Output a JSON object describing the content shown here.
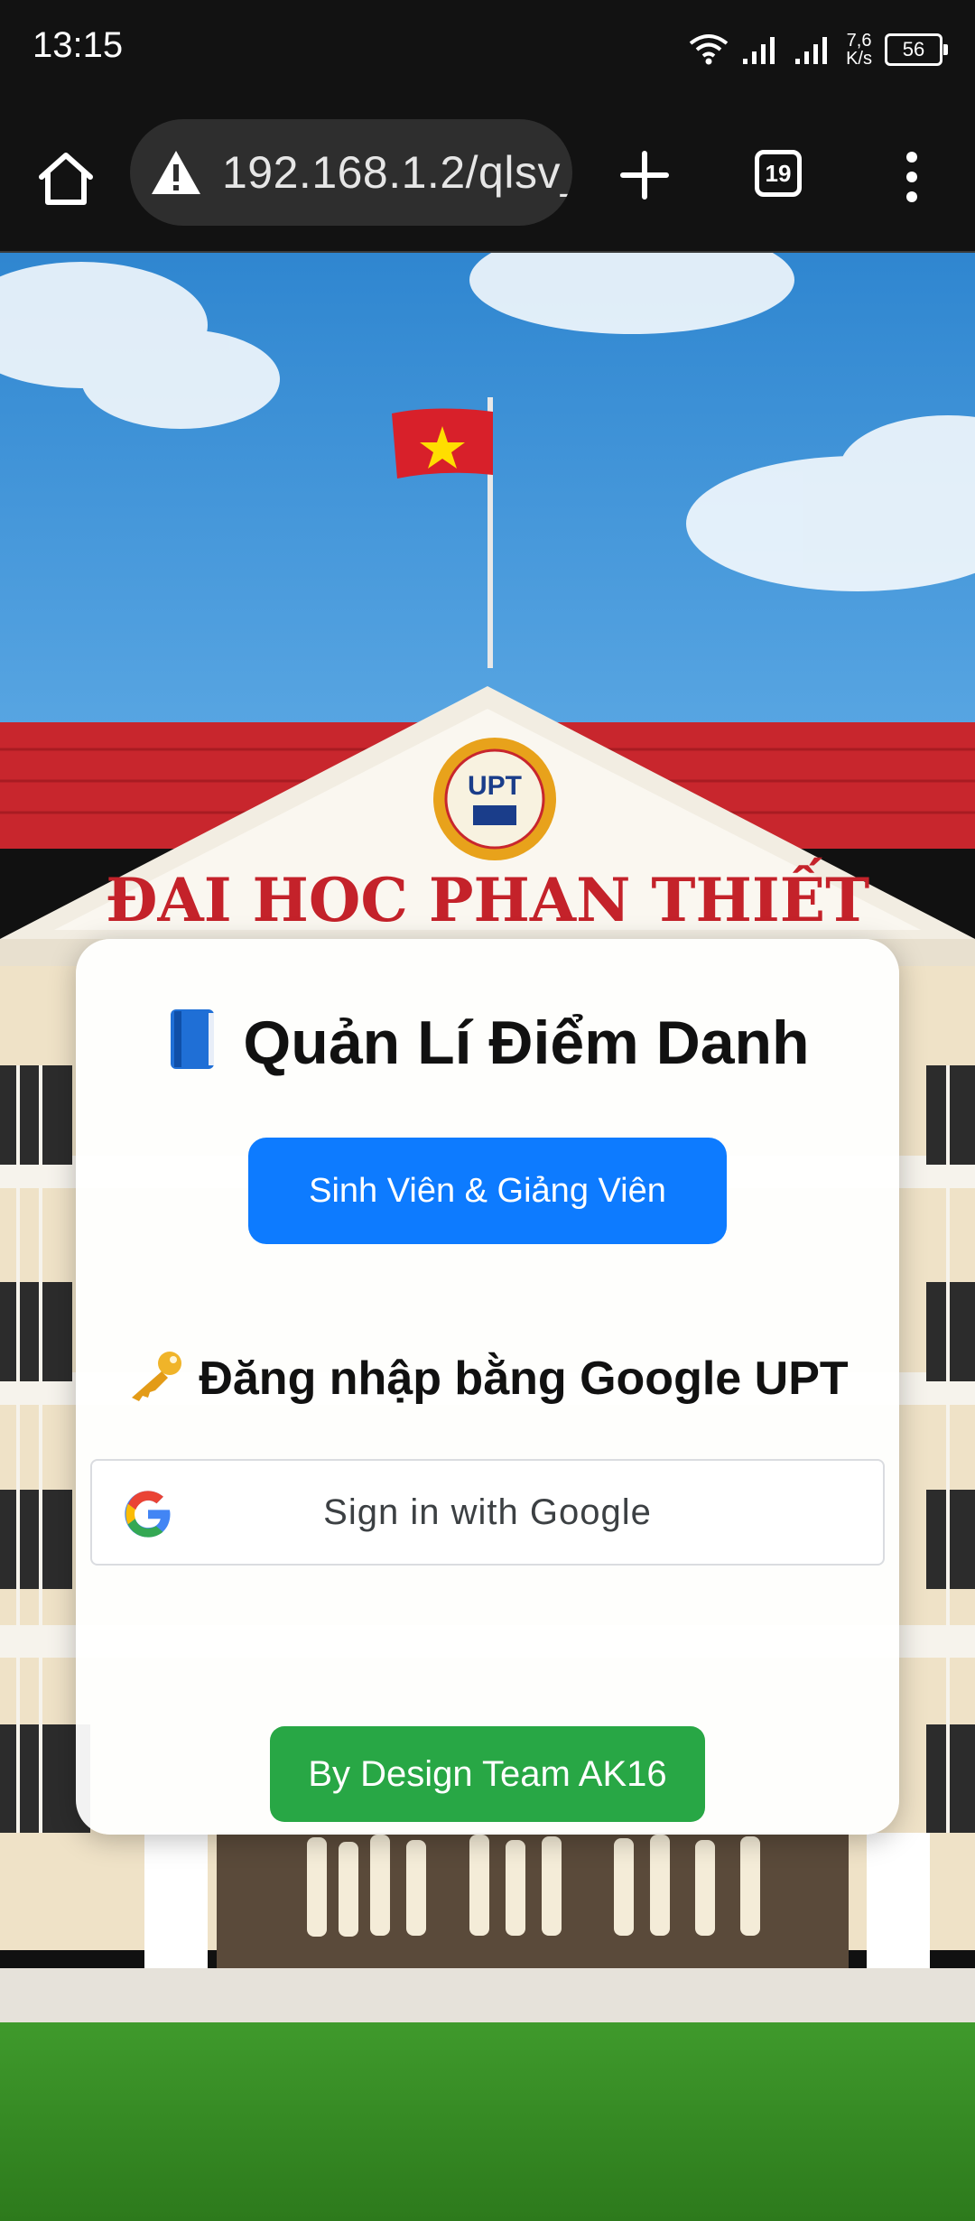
{
  "status_bar": {
    "time": "13:15",
    "net_speed_value": "7,6",
    "net_speed_unit": "K/s",
    "battery": "56",
    "icons": [
      "wifi-icon",
      "signal-icon",
      "signal-icon",
      "battery-icon"
    ]
  },
  "browser": {
    "url": "192.168.1.2/qlsv_",
    "tab_count": "19",
    "icons": [
      "home-icon",
      "warning-icon",
      "plus-icon",
      "more-vert-icon"
    ]
  },
  "background": {
    "building_sign": "ĐAI HOC PHAN THIẾT",
    "logo_text": "UPT"
  },
  "card": {
    "title": "Quản Lí Điểm Danh",
    "role_button": "Sinh Viên & Giảng Viên",
    "google_heading": "Đăng nhập bằng Google UPT",
    "google_button": "Sign in with Google",
    "credit_button": "By Design Team AK16"
  },
  "colors": {
    "primary_button": "#0d7bff",
    "credit_button": "#28a745",
    "roof": "#c8262d",
    "sky": "#3d8fd4"
  }
}
